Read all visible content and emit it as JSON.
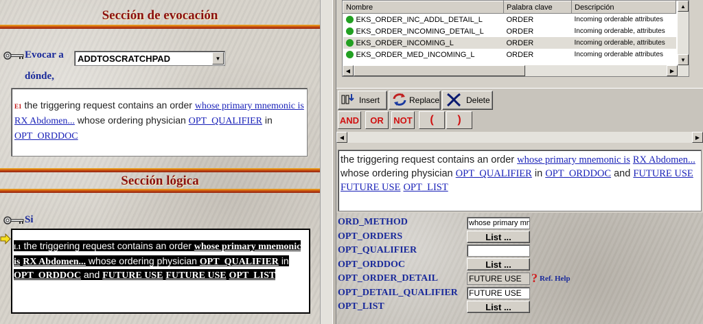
{
  "left": {
    "evocation_title": "Sección de evocación",
    "evoke_label": "Evocar a",
    "evoke_value": "ADDTOSCRATCHPAD",
    "where_label": "dónde,",
    "evoke_rule": {
      "tag": "E1",
      "t1": "the triggering request contains an order",
      "l1": "whose primary mnemonic is",
      "l2": "RX Abdomen...",
      "t2": "whose ordering physician",
      "l3": "OPT_QUALIFIER",
      "t3": "in",
      "l4": "OPT_ORDDOC"
    },
    "logic_title": "Sección lógica",
    "if_label": "Si",
    "logic_rule": {
      "tag": "L1",
      "t1": "the triggering request contains an order",
      "l1": "whose primary mnemonic is",
      "l2": "RX Abdomen...",
      "t2": "whose ordering physician",
      "l3": "OPT_QUALIFIER",
      "t3": "in",
      "l4": "OPT_ORDDOC",
      "t4": "and",
      "l5": "FUTURE USE",
      "l6": "FUTURE USE",
      "l7": "OPT_LIST"
    }
  },
  "right": {
    "columns": [
      "Nombre",
      "Palabra clave",
      "Descripción"
    ],
    "rows": [
      {
        "name": "EKS_ORDER_INC_ADDL_DETAIL_L",
        "keyword": "ORDER",
        "desc": "Incoming orderable attributes"
      },
      {
        "name": "EKS_ORDER_INCOMING_DETAIL_L",
        "keyword": "ORDER",
        "desc": "Incoming orderable, attributes"
      },
      {
        "name": "EKS_ORDER_INCOMING_L",
        "keyword": "ORDER",
        "desc": "Incoming orderable, attributes"
      },
      {
        "name": "EKS_ORDER_MED_INCOMING_L",
        "keyword": "ORDER",
        "desc": "Incoming orderable attributes"
      }
    ],
    "toolbar": {
      "insert": "Insert",
      "replace": "Replace",
      "delete": "Delete"
    },
    "logic_ops": [
      "AND",
      "OR",
      "NOT",
      "(",
      ")"
    ],
    "preview": {
      "t1": "the triggering request contains an order",
      "l1": "whose primary mnemonic is",
      "l2": "RX Abdomen...",
      "t2": "whose ordering physician",
      "l3": "OPT_QUALIFIER",
      "t3": "in",
      "l4": "OPT_ORDDOC",
      "t4": "and",
      "l5": "FUTURE USE",
      "l6": "FUTURE USE",
      "l7": "OPT_LIST"
    },
    "params": [
      {
        "label": "ORD_METHOD",
        "value": "whose primary mn"
      },
      {
        "label": "OPT_ORDERS",
        "button": "List ..."
      },
      {
        "label": "OPT_QUALIFIER",
        "value": ""
      },
      {
        "label": "OPT_ORDDOC",
        "button": "List ..."
      },
      {
        "label": "OPT_ORDER_DETAIL",
        "value": "FUTURE USE",
        "help": "Ref. Help"
      },
      {
        "label": "OPT_DETAIL_QUALIFIER",
        "value": "FUTURE USE"
      },
      {
        "label": "OPT_LIST",
        "button": "List ..."
      }
    ]
  }
}
